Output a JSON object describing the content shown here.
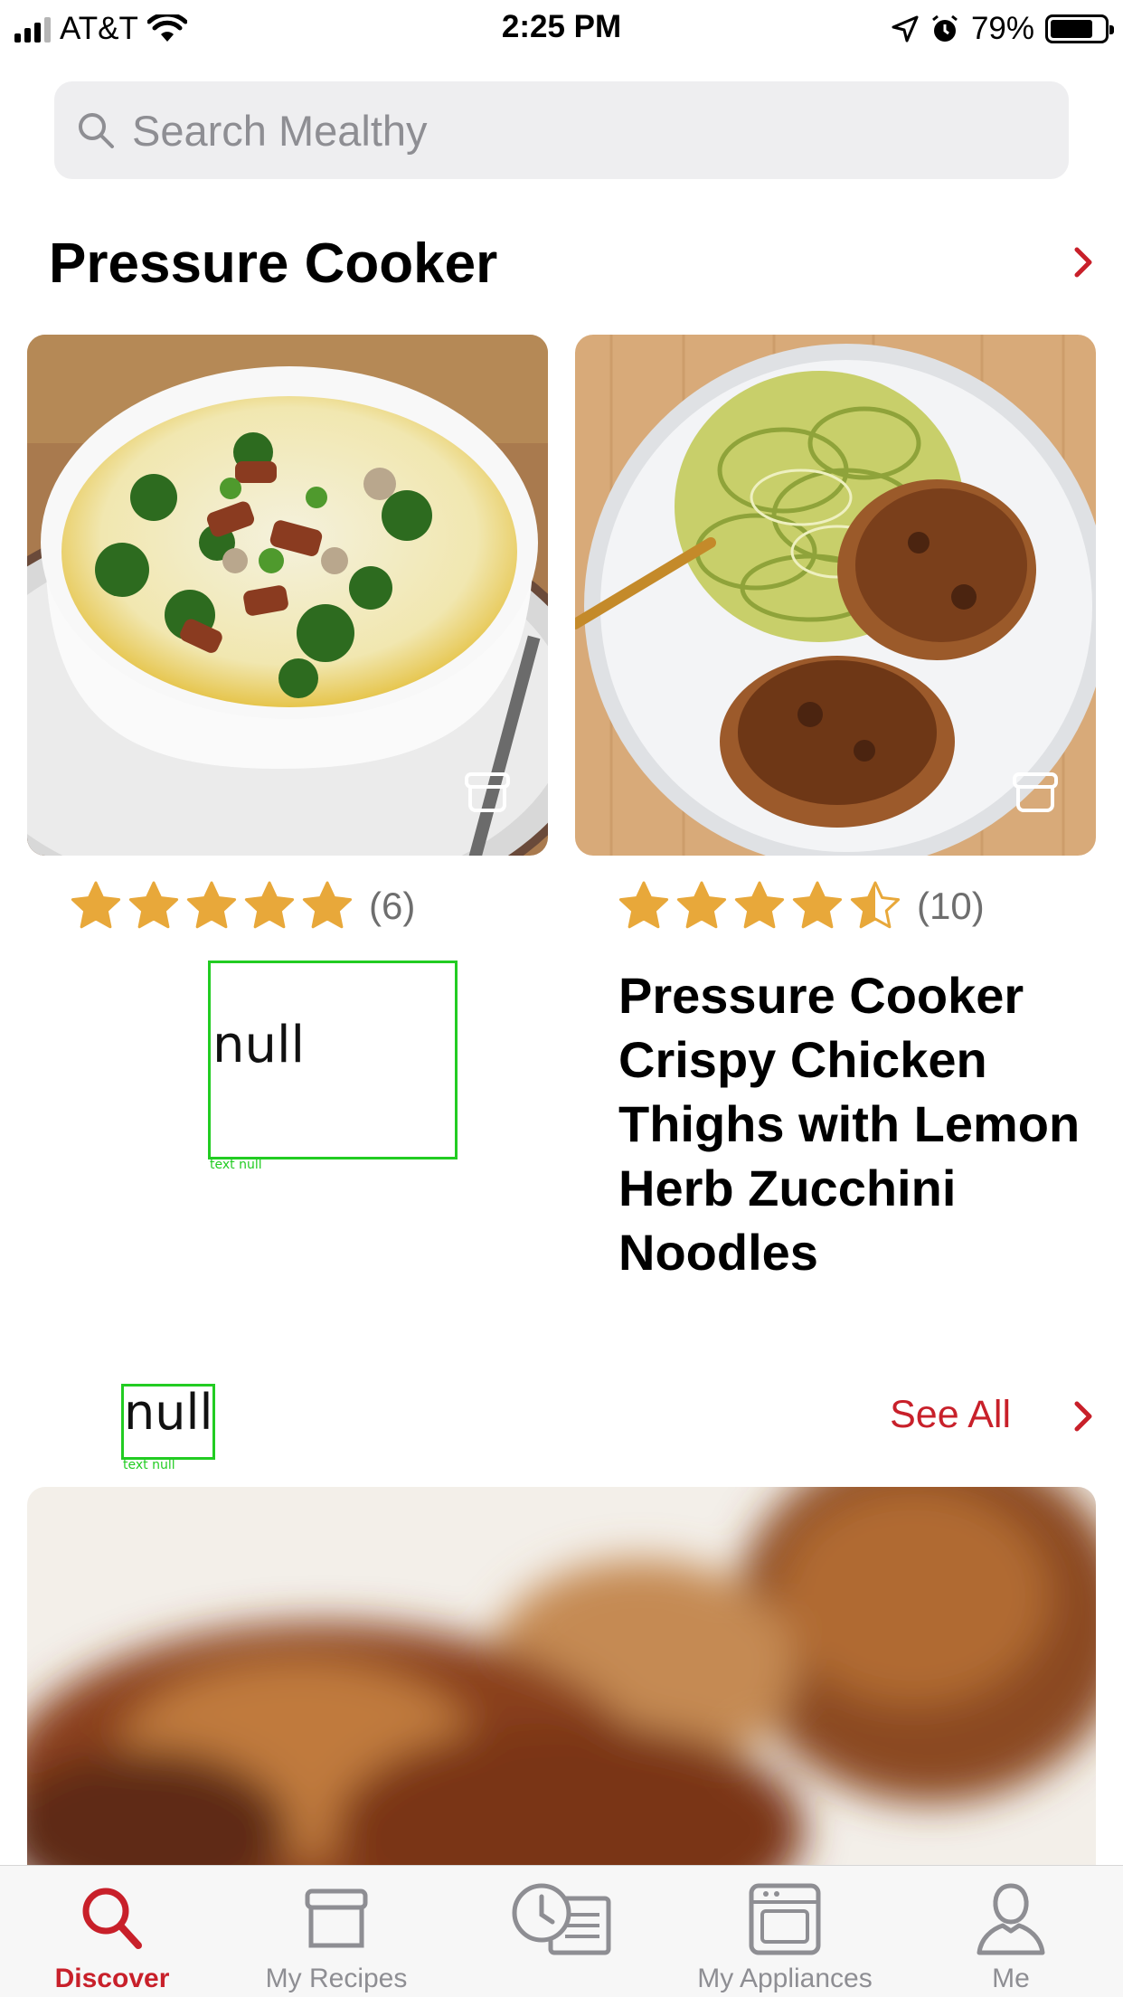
{
  "status_bar": {
    "carrier": "AT&T",
    "time": "2:25 PM",
    "battery_percent": "79%",
    "battery_level": 0.79
  },
  "search": {
    "placeholder": "Search Mealthy"
  },
  "section1": {
    "title": "Pressure Cooker"
  },
  "recipes": [
    {
      "rating": 5,
      "rating_count": "(6)",
      "title": "null",
      "debug_tag": "text null"
    },
    {
      "rating": 4.5,
      "rating_count": "(10)",
      "title": "Pressure Cooker Crispy Chicken Thighs with Lemon Herb Zucchini Noodles"
    }
  ],
  "section2": {
    "title": "null",
    "debug_tag": "text null",
    "see_all": "See All"
  },
  "tabs": [
    {
      "label": "Discover",
      "icon": "search-icon",
      "active": true
    },
    {
      "label": "My Recipes",
      "icon": "recipe-box-icon",
      "active": false
    },
    {
      "label": "",
      "icon": "history-clock-icon",
      "active": false
    },
    {
      "label": "My Appliances",
      "icon": "appliance-icon",
      "active": false
    },
    {
      "label": "Me",
      "icon": "person-icon",
      "active": false
    }
  ],
  "colors": {
    "accent": "#c8202a",
    "star": "#e8a83a",
    "search_bg": "#eeeef0"
  }
}
